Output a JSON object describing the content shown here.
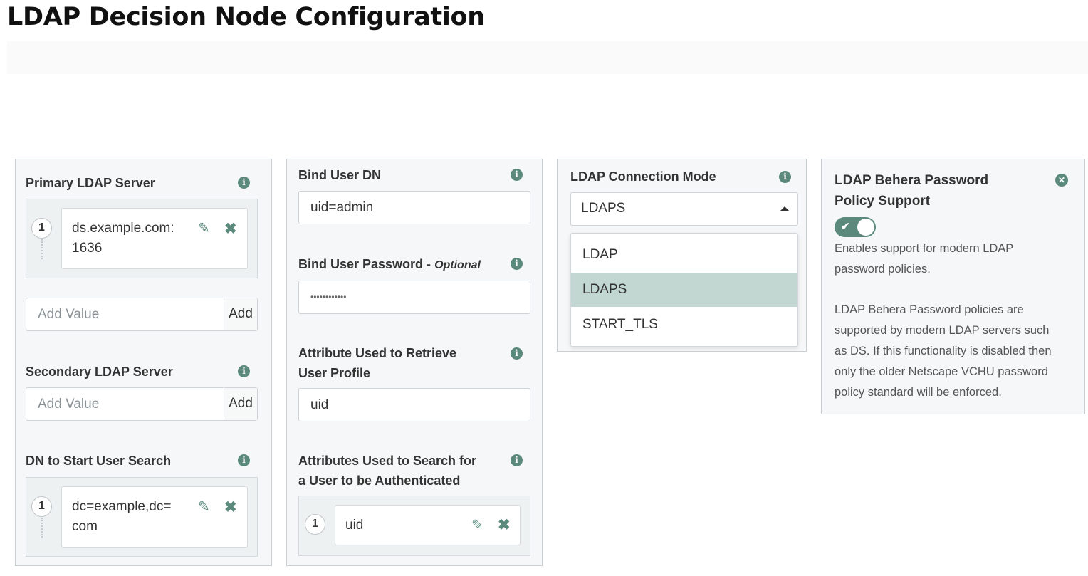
{
  "page": {
    "title": "LDAP Decision Node Configuration"
  },
  "panel1": {
    "primary_label": "Primary LDAP Server",
    "primary_items": [
      {
        "index": "1",
        "line1": "ds.example.com:",
        "line2": "1636"
      }
    ],
    "primary_add_placeholder": "Add Value",
    "primary_add_button": "Add",
    "secondary_label": "Secondary LDAP Server",
    "secondary_add_placeholder": "Add Value",
    "secondary_add_button": "Add",
    "dn_label": "DN to Start User Search",
    "dn_items": [
      {
        "index": "1",
        "line1": "dc=example,dc=",
        "line2": "com"
      }
    ]
  },
  "panel2": {
    "bind_dn_label": "Bind User DN",
    "bind_dn_value": "uid=admin",
    "bind_pw_label": "Bind User Password -",
    "bind_pw_optional": "Optional",
    "bind_pw_value": "••••••••••••",
    "attr_profile_label_1": "Attribute Used to Retrieve",
    "attr_profile_label_2": "User Profile",
    "attr_profile_value": "uid",
    "attr_search_label_1": "Attributes Used to Search for",
    "attr_search_label_2": "a User to be Authenticated",
    "attr_search_items": [
      {
        "index": "1",
        "text": "uid"
      }
    ]
  },
  "panel3": {
    "mode_label": "LDAP Connection Mode",
    "selected": "LDAPS",
    "options": [
      "LDAP",
      "LDAPS",
      "START_TLS"
    ]
  },
  "panel4": {
    "title_1": "LDAP Behera Password",
    "title_2": "Policy Support",
    "toggle_on": true,
    "desc1_line1": "Enables support for modern LDAP",
    "desc1_line2": "password policies.",
    "desc2_lines": [
      "LDAP Behera Password policies are",
      "supported by modern LDAP servers such",
      "as DS. If this functionality is disabled then",
      "only the older Netscape VCHU password",
      "policy standard will be enforced."
    ]
  },
  "colors": {
    "accent": "#5b8a7d",
    "selected_option": "#c2d7d2",
    "panel_bg": "#f5f7f8"
  },
  "icons": {
    "info": "info-icon",
    "edit": "pencil-icon",
    "remove": "x-icon",
    "close": "close-circle-icon",
    "dropdown": "caret-up-icon",
    "toggle_check": "check-icon"
  }
}
